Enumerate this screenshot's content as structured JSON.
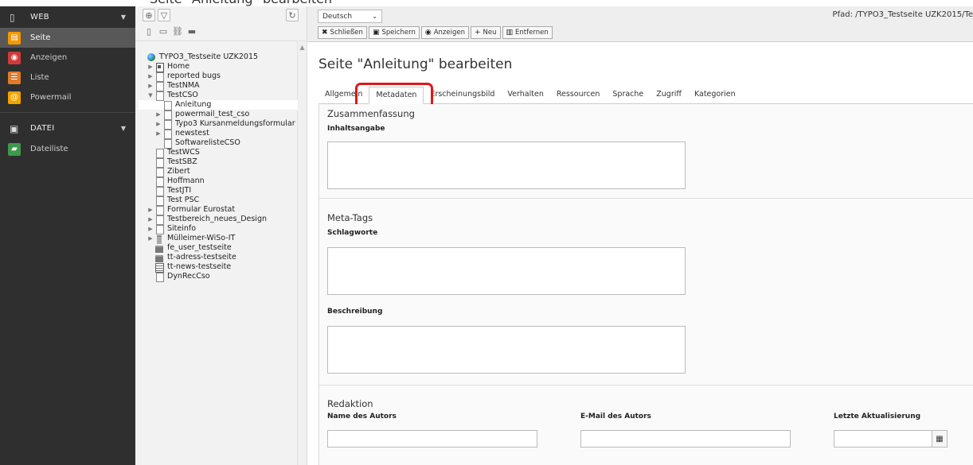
{
  "top_strip": {
    "text": "Seite \"Anleitung\" bearbeiten"
  },
  "module_menu": {
    "groups": [
      {
        "label": "WEB",
        "icon": "page-icon",
        "items": [
          {
            "label": "Seite",
            "icon": "page-module-icon",
            "color": "#f49700",
            "active": true
          },
          {
            "label": "Anzeigen",
            "icon": "eye-icon",
            "color": "#d13a3a"
          },
          {
            "label": "Liste",
            "icon": "list-icon",
            "color": "#e07c2a"
          },
          {
            "label": "Powermail",
            "icon": "powermail-icon",
            "color": "#f2a400"
          }
        ]
      },
      {
        "label": "DATEI",
        "icon": "image-icon",
        "items": [
          {
            "label": "Dateiliste",
            "icon": "filelist-icon",
            "color": "#3d9a4a"
          }
        ]
      }
    ]
  },
  "page_tree": {
    "nodes": [
      {
        "label": "TYPO3_Testseite UZK2015",
        "icon": "globe",
        "toggle": "",
        "depth": 0
      },
      {
        "label": "Home",
        "icon": "home",
        "toggle": "▶",
        "depth": 1
      },
      {
        "label": "reported bugs",
        "icon": "page",
        "toggle": "▶",
        "depth": 1
      },
      {
        "label": "TestNMA",
        "icon": "page",
        "toggle": "▶",
        "depth": 1
      },
      {
        "label": "TestCSO",
        "icon": "page",
        "toggle": "▼",
        "depth": 1
      },
      {
        "label": "Anleitung",
        "icon": "page",
        "toggle": "",
        "depth": 2,
        "selected": true
      },
      {
        "label": "powermail_test_cso",
        "icon": "page",
        "toggle": "▶",
        "depth": 2
      },
      {
        "label": "Typo3 Kursanmeldungsformular",
        "icon": "page",
        "toggle": "▶",
        "depth": 2
      },
      {
        "label": "newstest",
        "icon": "page",
        "toggle": "▶",
        "depth": 2
      },
      {
        "label": "SoftwarelisteCSO",
        "icon": "page",
        "toggle": "",
        "depth": 2
      },
      {
        "label": "TestWCS",
        "icon": "page",
        "toggle": "",
        "depth": 1
      },
      {
        "label": "TestSBZ",
        "icon": "page",
        "toggle": "",
        "depth": 1
      },
      {
        "label": "Zibert",
        "icon": "page",
        "toggle": "",
        "depth": 1
      },
      {
        "label": "Hoffmann",
        "icon": "page",
        "toggle": "",
        "depth": 1
      },
      {
        "label": "TestJTI",
        "icon": "page",
        "toggle": "",
        "depth": 1
      },
      {
        "label": "Test PSC",
        "icon": "page",
        "toggle": "",
        "depth": 1
      },
      {
        "label": "Formular Eurostat",
        "icon": "page",
        "toggle": "▶",
        "depth": 1
      },
      {
        "label": "Testbereich_neues_Design",
        "icon": "page",
        "toggle": "▶",
        "depth": 1
      },
      {
        "label": "Siteinfo",
        "icon": "page",
        "toggle": "▶",
        "depth": 1
      },
      {
        "label": "Mülleimer-WiSo-IT",
        "icon": "trash",
        "toggle": "▶",
        "depth": 1
      },
      {
        "label": "fe_user_testseite",
        "icon": "folder",
        "toggle": "",
        "depth": 1
      },
      {
        "label": "tt-adress-testseite",
        "icon": "folder",
        "toggle": "",
        "depth": 1
      },
      {
        "label": "tt-news-testseite",
        "icon": "list",
        "toggle": "",
        "depth": 1
      },
      {
        "label": "DynRecCso",
        "icon": "page",
        "toggle": "",
        "depth": 1
      }
    ]
  },
  "doc_header": {
    "language": "Deutsch",
    "path": "Pfad: /TYPO3_Testseite UZK2015/Te",
    "buttons": [
      {
        "label": "Schließen",
        "icon": "close-icon",
        "glyph": "✖"
      },
      {
        "label": "Speichern",
        "icon": "save-icon",
        "glyph": "▣"
      },
      {
        "label": "Anzeigen",
        "icon": "view-icon",
        "glyph": "◉"
      },
      {
        "label": "Neu",
        "icon": "plus-icon",
        "glyph": "+"
      },
      {
        "label": "Entfernen",
        "icon": "delete-icon",
        "glyph": "▥"
      }
    ]
  },
  "editor": {
    "title": "Seite \"Anleitung\" bearbeiten",
    "tabs": [
      "Allgemein",
      "Metadaten",
      "Erscheinungsbild",
      "Verhalten",
      "Ressourcen",
      "Sprache",
      "Zugriff",
      "Kategorien"
    ],
    "active_tab": "Metadaten",
    "sections": {
      "summary": {
        "title": "Zusammenfassung",
        "field": "Inhaltsangabe"
      },
      "meta": {
        "title": "Meta-Tags",
        "keywords": "Schlagworte",
        "description": "Beschreibung"
      },
      "editorial": {
        "title": "Redaktion",
        "author": "Name des Autors",
        "email": "E-Mail des Autors",
        "updated": "Letzte Aktualisierung"
      }
    }
  },
  "colors": {
    "highlight": "#e01818",
    "menu_bg": "#2f2f2f",
    "menu_active": "#585858"
  }
}
